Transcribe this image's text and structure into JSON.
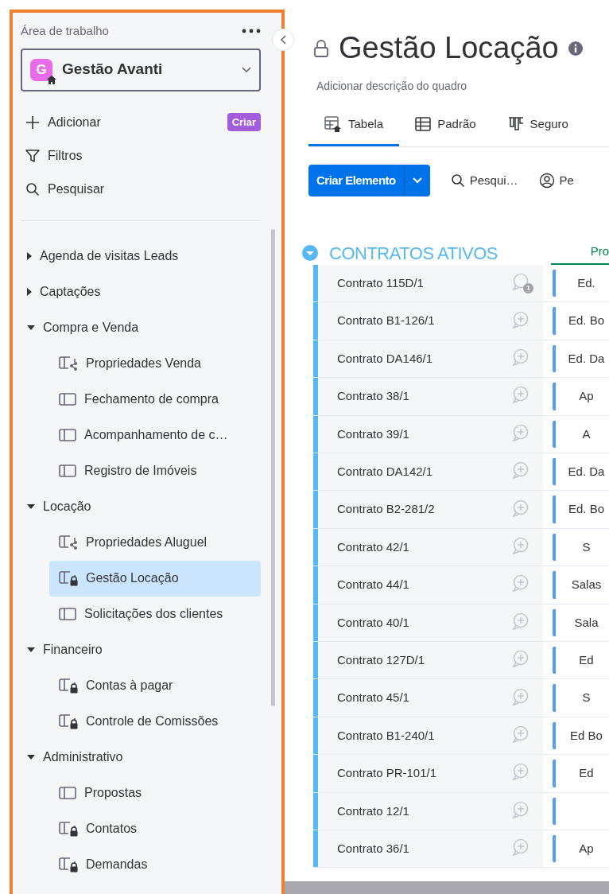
{
  "sidebar": {
    "heading": "Área de trabalho",
    "workspace": {
      "initial": "G",
      "name": "Gestão Avanti"
    },
    "actions": [
      {
        "kind": "add",
        "label": "Adicionar",
        "badge": "Criar"
      },
      {
        "kind": "filter",
        "label": "Filtros"
      },
      {
        "kind": "search",
        "label": "Pesquisar"
      }
    ],
    "tree": [
      {
        "label": "Agenda de visitas Leads",
        "expanded": false
      },
      {
        "label": "Captações",
        "expanded": false
      },
      {
        "label": "Compra e Venda",
        "expanded": true,
        "children": [
          {
            "label": "Propriedades Venda",
            "kind": "shared",
            "selected": false
          },
          {
            "label": "Fechamento de compra",
            "kind": "board",
            "selected": false
          },
          {
            "label": "Acompanhamento de c…",
            "kind": "board",
            "selected": false
          },
          {
            "label": "Registro de Imóveis",
            "kind": "board",
            "selected": false
          }
        ]
      },
      {
        "label": "Locação",
        "expanded": true,
        "children": [
          {
            "label": "Propriedades Aluguel",
            "kind": "shared",
            "selected": false
          },
          {
            "label": "Gestão Locação",
            "kind": "private",
            "selected": true
          },
          {
            "label": "Solicitações dos clientes",
            "kind": "board",
            "selected": false
          }
        ]
      },
      {
        "label": "Financeiro",
        "expanded": true,
        "children": [
          {
            "label": "Contas à pagar",
            "kind": "private",
            "selected": false
          },
          {
            "label": "Controle de Comissões",
            "kind": "private",
            "selected": false
          }
        ]
      },
      {
        "label": "Administrativo",
        "expanded": true,
        "children": [
          {
            "label": "Propostas",
            "kind": "board",
            "selected": false
          },
          {
            "label": "Contatos",
            "kind": "private",
            "selected": false
          },
          {
            "label": "Demandas",
            "kind": "private",
            "selected": false
          }
        ]
      }
    ]
  },
  "board": {
    "title": "Gestão Locação",
    "description": "Adicionar descrição do quadro",
    "tabs": [
      {
        "label": "Tabela",
        "kind": "table",
        "selected": true
      },
      {
        "label": "Padrão",
        "kind": "grid",
        "selected": false
      },
      {
        "label": "Seguro",
        "kind": "kanban",
        "selected": false
      }
    ],
    "toolbar": {
      "primary": "Criar Elemento",
      "search": "Pesqui…",
      "person": "Pe"
    },
    "group": {
      "title": "CONTRATOS ATIVOS",
      "column_1": "Pro",
      "rows": [
        {
          "name": "Contrato 115D/1",
          "updates": "1",
          "column_1": "Ed."
        },
        {
          "name": "Contrato B1-126/1",
          "column_1": "Ed. Bo"
        },
        {
          "name": "Contrato DA146/1",
          "column_1": "Ed. Da"
        },
        {
          "name": "Contrato 38/1",
          "column_1": "Ap"
        },
        {
          "name": "Contrato 39/1",
          "column_1": "A"
        },
        {
          "name": "Contrato DA142/1",
          "column_1": "Ed. Da"
        },
        {
          "name": "Contrato B2-281/2",
          "column_1": "Ed. Bo"
        },
        {
          "name": "Contrato 42/1",
          "column_1": "S"
        },
        {
          "name": "Contrato 44/1",
          "column_1": "Salas"
        },
        {
          "name": "Contrato 40/1",
          "column_1": "Sala"
        },
        {
          "name": "Contrato 127D/1",
          "column_1": "Ed"
        },
        {
          "name": "Contrato 45/1",
          "column_1": "S"
        },
        {
          "name": "Contrato B1-240/1",
          "column_1": "Ed Bo"
        },
        {
          "name": "Contrato PR-101/1",
          "column_1": "Ed"
        },
        {
          "name": "Contrato 12/1"
        },
        {
          "name": "Contrato 36/1",
          "column_1": "Ap"
        }
      ]
    }
  }
}
